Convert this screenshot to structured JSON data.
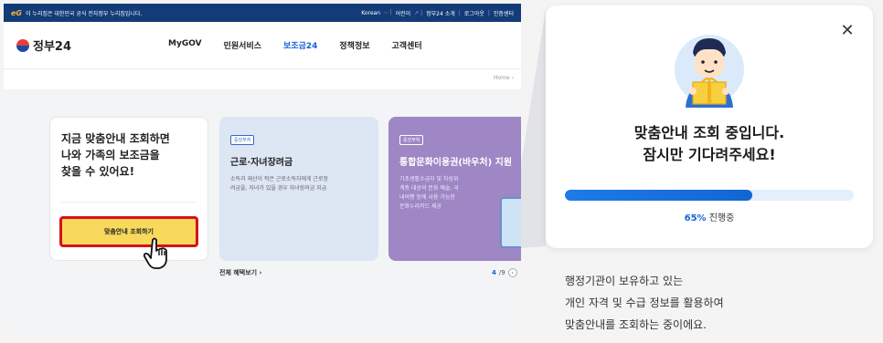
{
  "gov_banner": {
    "logo": "eG",
    "notice": "이 누리집은 대한민국 공식 전자정부 누리집입니다.",
    "links": [
      "Korean",
      "어린이",
      "정부24 소개",
      "로그아웃",
      "인증센터"
    ]
  },
  "header": {
    "logo_text": "정부24",
    "nav": [
      "MyGOV",
      "민원서비스",
      "보조금24",
      "정책정보",
      "고객센터"
    ],
    "active_nav": "보조금24"
  },
  "breadcrumb": "Home",
  "main_card": {
    "title_lines": [
      "지금 맞춤안내 조회하면",
      "나와 가족의 보조금을",
      "찾을 수 있어요!"
    ],
    "cta_label": "맞춤안내 조회하기"
  },
  "benefit_card": {
    "tag": "중앙부처",
    "title": "근로·자녀장려금",
    "desc_lines": [
      "소득과 재산이 적은 근로소득자에게 근로장",
      "려금을, 자녀가 있을 경우 자녀장려금 지급"
    ]
  },
  "voucher_card": {
    "tag": "중앙부처",
    "title": "통합문화이용권(바우처) 지원",
    "desc_lines": [
      "기초생활수급자 및 차상위",
      "계층 대상의 문화 예술, 국",
      "내여행 등에 사용 가능한",
      "문화누리카드 제공"
    ]
  },
  "more_link": "전체 혜택보기",
  "pager": {
    "current": "4",
    "total": "/9"
  },
  "modal": {
    "title_lines": [
      "맞춤안내 조회 중입니다.",
      "잠시만 기다려주세요!"
    ],
    "progress_percent": 65,
    "progress_pct_text": "65%",
    "progress_status": "진행중"
  },
  "description_lines": [
    "행정기관이 보유하고 있는",
    "개인 자격 및 수급 정보를 활용하여",
    "맞춤안내를 조회하는 중이에요."
  ],
  "colors": {
    "gov_navy": "#123b78",
    "accent_blue": "#1560d9",
    "cta_yellow": "#f8d95c",
    "cta_border_red": "#d5121b",
    "voucher_purple": "#9f86c4"
  }
}
